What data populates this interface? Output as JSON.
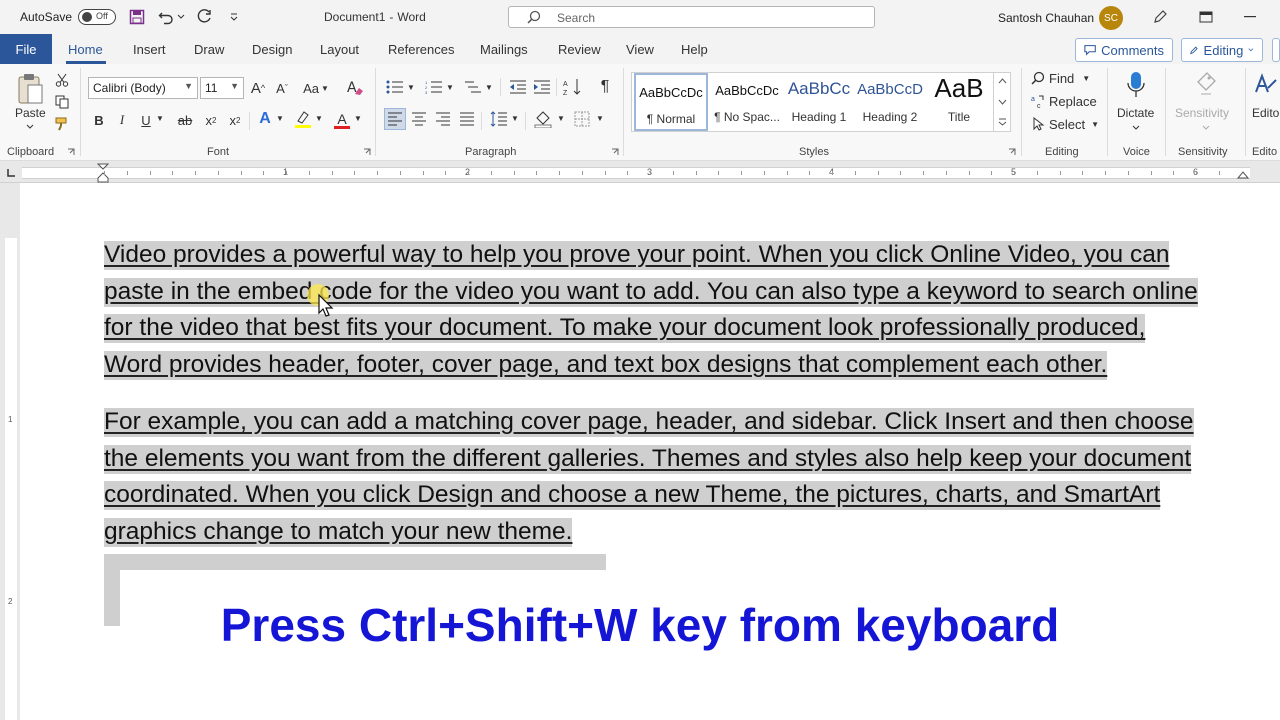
{
  "titlebar": {
    "autosave_label": "AutoSave",
    "autosave_state": "Off",
    "doc_name": "Document1",
    "separator": "-",
    "app_name": "Word",
    "search_placeholder": "Search",
    "user_name": "Santosh Chauhan",
    "user_initials": "SC"
  },
  "tabs": {
    "file": "File",
    "items": [
      "Home",
      "Insert",
      "Draw",
      "Design",
      "Layout",
      "References",
      "Mailings",
      "Review",
      "View",
      "Help"
    ],
    "active": "Home",
    "comments": "Comments",
    "editing": "Editing"
  },
  "ribbon": {
    "clipboard": {
      "paste": "Paste",
      "label": "Clipboard"
    },
    "font": {
      "family": "Calibri (Body)",
      "size": "11",
      "grow": "A",
      "shrink": "A",
      "change_case": "Aa",
      "bold": "B",
      "italic": "I",
      "underline": "U",
      "strike": "ab",
      "subscript": "x",
      "superscript": "x",
      "text_effects": "A",
      "font_color": "A",
      "label": "Font"
    },
    "paragraph": {
      "label": "Paragraph",
      "pilcrow": "¶"
    },
    "styles": {
      "label": "Styles",
      "tiles": [
        {
          "sample": "AaBbCcDc",
          "name": "¶ Normal"
        },
        {
          "sample": "AaBbCcDc",
          "name": "¶ No Spac..."
        },
        {
          "sample": "AaBbCc",
          "name": "Heading 1"
        },
        {
          "sample": "AaBbCcD",
          "name": "Heading 2"
        },
        {
          "sample": "AaB",
          "name": "Title"
        }
      ]
    },
    "editing": {
      "label": "Editing",
      "find": "Find",
      "replace": "Replace",
      "select": "Select"
    },
    "voice": {
      "label": "Voice",
      "dictate": "Dictate"
    },
    "sensitivity": {
      "label": "Sensitivity",
      "button": "Sensitivity"
    },
    "editor": {
      "label": "Edito",
      "button": "Edito"
    }
  },
  "ruler": {
    "numbers": [
      "1",
      "2",
      "3",
      "4",
      "5",
      "6"
    ],
    "vertical_numbers": [
      "1",
      "2"
    ]
  },
  "document": {
    "paragraph1": [
      "Video provides a powerful way to help you prove your point. When you click Online Video, you can",
      "paste in the embed code for the video you want to add. You can also type a keyword to search online",
      "for the video that best fits your document. To make your document look professionally produced,",
      "Word provides header, footer, cover page, and text box designs that complement each other."
    ],
    "paragraph2": [
      "For example, you can add a matching cover page, header, and sidebar. Click Insert and then choose",
      "the elements you want from the different galleries. Themes and styles also help keep your document",
      "coordinated. When you click Design and choose a new Theme, the pictures, charts, and SmartArt",
      "graphics change to match your new theme."
    ]
  },
  "overlay": {
    "message": "Press Ctrl+Shift+W key from keyboard"
  },
  "colors": {
    "brand": "#2b579a",
    "highlight": "#cfcfcf",
    "overlay_text": "#1515d6"
  }
}
